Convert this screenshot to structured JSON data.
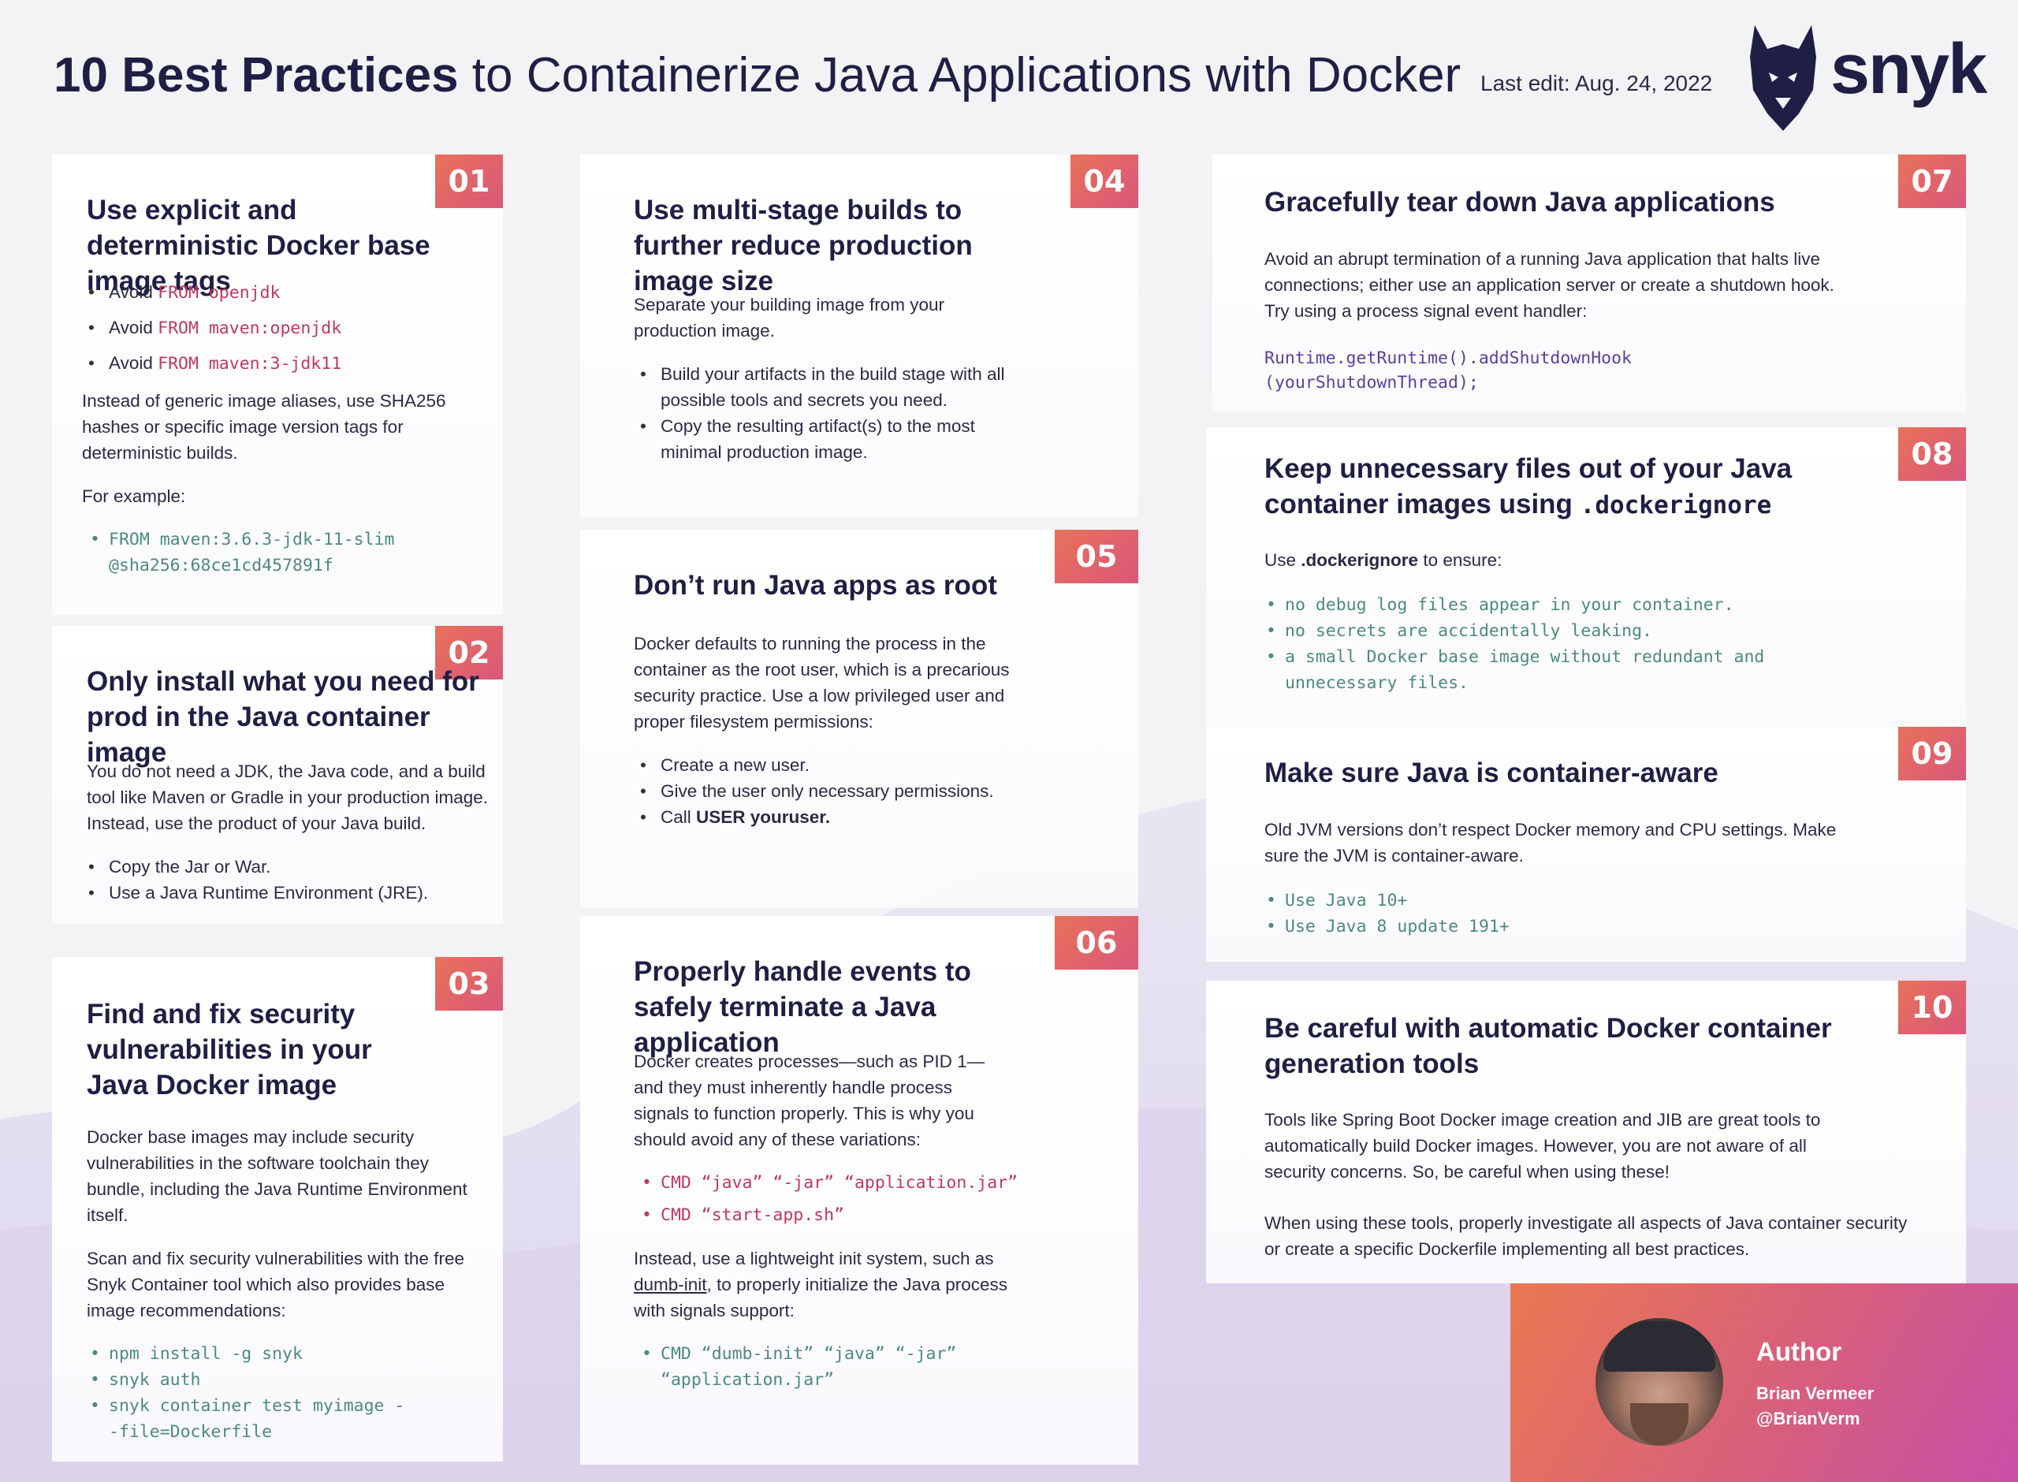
{
  "header": {
    "title_bold": "10 Best Practices",
    "title_rest": " to Containerize Java Applications with Docker",
    "last_edit": "Last edit: Aug. 24, 2022",
    "logo_text": "snyk"
  },
  "cards": {
    "c01": {
      "number": "01",
      "title": "Use explicit and deterministic Docker base image tags",
      "items": [
        {
          "prefix": "Avoid ",
          "kw": "FROM",
          "code": " openjdk"
        },
        {
          "prefix": "Avoid ",
          "kw": "FROM",
          "code": " maven:openjdk"
        },
        {
          "prefix": "Avoid ",
          "kw": "FROM",
          "code": " maven:3-jdk11"
        }
      ],
      "body": "Instead of generic image aliases, use SHA256 hashes or specific image version tags for deterministic builds.",
      "example_label": "For example:",
      "example_code": "FROM maven:3.6.3-jdk-11-slim@sha256:68ce1cd457891f"
    },
    "c02": {
      "number": "02",
      "title": "Only install what you need for prod in the Java container image",
      "body": "You do not need a JDK, the Java code, and a build tool like Maven or Gradle in your production image. Instead, use the product of your Java build.",
      "items": [
        "Copy the Jar or War.",
        "Use a Java Runtime Environment (JRE)."
      ]
    },
    "c03": {
      "number": "03",
      "title": "Find and fix security vulnerabilities in your Java Docker image",
      "body1": "Docker base images may include security vulnerabilities in the software toolchain they bundle, including the Java Runtime Environment itself.",
      "body2": "Scan and fix security vulnerabilities with the free Snyk Container tool which also provides base image recommendations:",
      "code": [
        "npm install -g snyk",
        "snyk auth",
        "snyk container test myimage --file=Dockerfile"
      ]
    },
    "c04": {
      "number": "04",
      "title": "Use multi-stage builds to further reduce production image size",
      "body": "Separate your building image from your production image.",
      "items": [
        "Build your artifacts in the build stage with all possible tools and secrets you need.",
        "Copy the resulting artifact(s) to the most minimal production image."
      ]
    },
    "c05": {
      "number": "05",
      "title": "Don’t run Java apps as root",
      "body": "Docker defaults to running the process in the container as the root user, which is a precarious security practice. Use a low privileged user and proper filesystem permissions:",
      "items": [
        "Create a new user.",
        "Give the user only necessary permissions."
      ],
      "last_prefix": "Call ",
      "last_bold": "USER youruser."
    },
    "c06": {
      "number": "06",
      "title": "Properly handle events to safely terminate a Java application",
      "body": "Docker creates processes—such as PID 1—and they must inherently handle process signals to function properly. This is why you should avoid any of these variations:",
      "bad": [
        "CMD “java” “-jar” “application.jar”",
        "CMD “start-app.sh”"
      ],
      "body2_prefix": "Instead, use a lightweight init system, such as ",
      "body2_link": "dumb-init",
      "body2_suffix": ", to properly initialize the Java process with signals support:",
      "good": "CMD “dumb-init” “java” “-jar” “application.jar”"
    },
    "c07": {
      "number": "07",
      "title": "Gracefully tear down Java applications",
      "body": "Avoid an abrupt termination of a running Java application that halts live connections; either use an application server or create a shutdown hook. Try using a process signal event handler:",
      "code1": "Runtime.getRuntime().addShutdownHook",
      "code2": "(yourShutdownThread);"
    },
    "c08": {
      "number": "08",
      "title_prefix": "Keep unnecessary files out of your Java container images using ",
      "title_code": ".dockerignore",
      "use_prefix": "Use ",
      "use_bold": ".dockerignore",
      "use_suffix": " to ensure:",
      "items": [
        "no debug log files appear in your container.",
        "no secrets are accidentally leaking.",
        "a small Docker base image without redundant and unnecessary files."
      ]
    },
    "c09": {
      "number": "09",
      "title": "Make sure Java is container-aware",
      "body": "Old JVM versions don’t respect Docker memory and CPU settings. Make sure the JVM is container-aware.",
      "items": [
        "Use Java 10+",
        "Use Java 8 update 191+"
      ]
    },
    "c10": {
      "number": "10",
      "title": "Be careful with automatic Docker container generation tools",
      "body1": "Tools like Spring Boot Docker image creation and JIB are great tools to automatically build Docker images. However, you are not aware of all security concerns. So, be careful when using these!",
      "body2": "When using these tools, properly investigate all aspects of Java container security or create a specific Dockerfile implementing all best practices."
    }
  },
  "author": {
    "label": "Author",
    "name": "Brian Vermeer",
    "handle": "@BrianVerm"
  },
  "colors": {
    "badge_start": "#e8725a",
    "badge_end": "#d9577a",
    "title": "#1f1f45",
    "code_red": "#c0395e",
    "code_green": "#4c8a7a",
    "code_purple": "#5a3fa0"
  }
}
